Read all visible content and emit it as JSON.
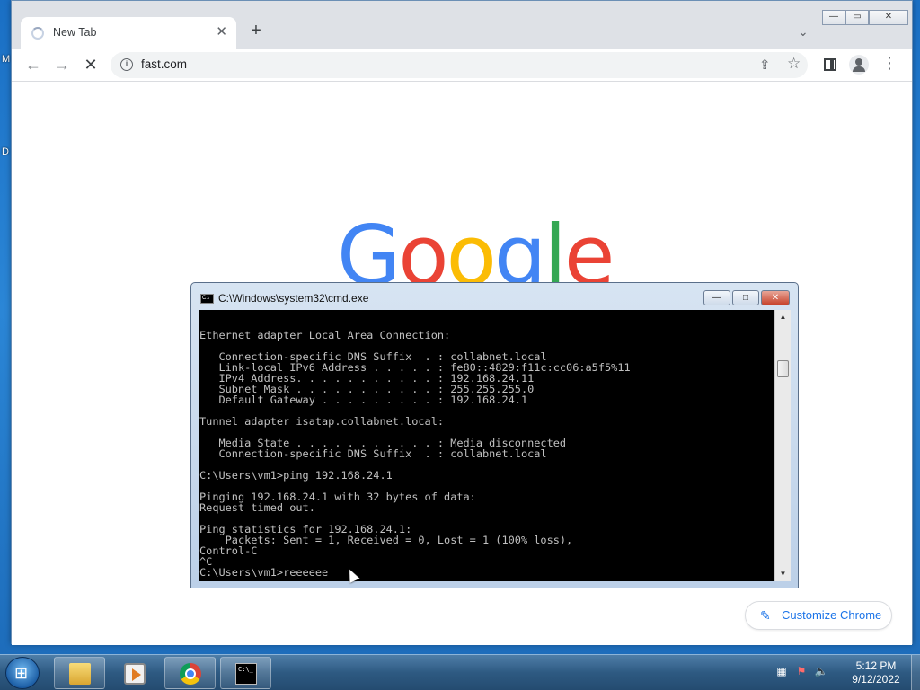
{
  "desktop": {
    "letter_m": "M",
    "letter_d": "D"
  },
  "browser": {
    "tab": {
      "title": "New Tab",
      "close_glyph": "✕"
    },
    "new_tab_glyph": "+",
    "tab_search_glyph": "⌄",
    "window_controls": {
      "minimize": "—",
      "maximize": "▭",
      "close": "✕"
    },
    "nav": {
      "back": "←",
      "forward": "→",
      "stop": "✕"
    },
    "omnibox": {
      "url": "fast.com",
      "info_glyph": "i"
    },
    "actions": {
      "share": "⇪",
      "star": "☆",
      "menu": "⋮"
    },
    "page": {
      "logo_letters": [
        {
          "ch": "G",
          "color": "#4285f4"
        },
        {
          "ch": "o",
          "color": "#ea4335"
        },
        {
          "ch": "o",
          "color": "#fbbc05"
        },
        {
          "ch": "g",
          "color": "#4285f4"
        },
        {
          "ch": "l",
          "color": "#34a853"
        },
        {
          "ch": "e",
          "color": "#ea4335"
        }
      ],
      "customize_label": "Customize Chrome",
      "pencil_glyph": "✎"
    }
  },
  "cmd": {
    "title": "C:\\Windows\\system32\\cmd.exe",
    "icon_text": "C:\\",
    "controls": {
      "minimize": "—",
      "maximize": "□",
      "close": "✕"
    },
    "scroll_up": "▲",
    "scroll_down": "▼",
    "output": "Ethernet adapter Local Area Connection:\n\n   Connection-specific DNS Suffix  . : collabnet.local\n   Link-local IPv6 Address . . . . . : fe80::4829:f11c:cc06:a5f5%11\n   IPv4 Address. . . . . . . . . . . : 192.168.24.11\n   Subnet Mask . . . . . . . . . . . : 255.255.255.0\n   Default Gateway . . . . . . . . . : 192.168.24.1\n\nTunnel adapter isatap.collabnet.local:\n\n   Media State . . . . . . . . . . . : Media disconnected\n   Connection-specific DNS Suffix  . : collabnet.local\n\nC:\\Users\\vm1>ping 192.168.24.1\n\nPinging 192.168.24.1 with 32 bytes of data:\nRequest timed out.\n\nPing statistics for 192.168.24.1:\n    Packets: Sent = 1, Received = 0, Lost = 1 (100% loss),\nControl-C\n^C\nC:\\Users\\vm1>reeeeee"
  },
  "taskbar": {
    "start_glyph": "⊞",
    "cmd_icon_text": "C:\\_",
    "tray": {
      "network": "▦",
      "flag": "⚑",
      "volume": "🔈"
    },
    "clock": {
      "time": "5:12 PM",
      "date": "9/12/2022"
    }
  }
}
